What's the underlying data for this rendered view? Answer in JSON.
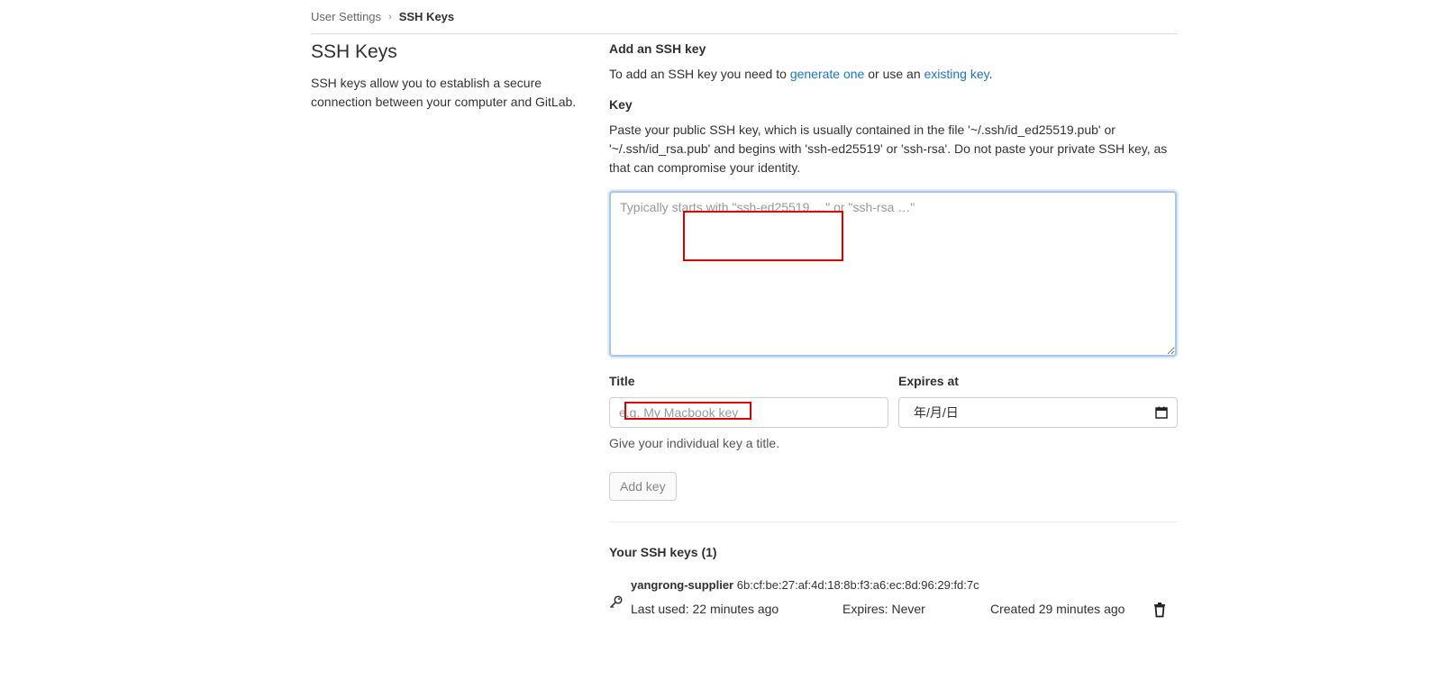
{
  "breadcrumb": {
    "parent": "User Settings",
    "separator": "›",
    "current": "SSH Keys"
  },
  "left": {
    "title": "SSH Keys",
    "description": "SSH keys allow you to establish a secure connection between your computer and GitLab."
  },
  "add_key": {
    "heading": "Add an SSH key",
    "intro_prefix": "To add an SSH key you need to ",
    "generate_link": "generate one",
    "intro_middle": " or use an ",
    "existing_link": "existing key",
    "intro_suffix": ".",
    "key_label": "Key",
    "key_help": "Paste your public SSH key, which is usually contained in the file '~/.ssh/id_ed25519.pub' or '~/.ssh/id_rsa.pub' and begins with 'ssh-ed25519' or 'ssh-rsa'. Do not paste your private SSH key, as that can compromise your identity.",
    "key_placeholder": "Typically starts with \"ssh-ed25519 …\" or \"ssh-rsa …\"",
    "key_value": "",
    "title_label": "Title",
    "title_placeholder": "e.g. My Macbook key",
    "title_value": "",
    "title_help": "Give your individual key a title.",
    "expires_label": "Expires at",
    "expires_value": "年/月/日",
    "submit_label": "Add key"
  },
  "your_keys": {
    "heading": "Your SSH keys (1)",
    "items": [
      {
        "title": "yangrong-supplier",
        "fingerprint": "6b:cf:be:27:af:4d:18:8b:f3:a6:ec:8d:96:29:fd:7c",
        "last_used": "Last used: 22 minutes ago",
        "expires": "Expires: Never",
        "created": "Created 29 minutes ago"
      }
    ]
  },
  "icons": {
    "calendar": "calendar-icon",
    "key": "key-icon",
    "delete": "trash-icon"
  },
  "colors": {
    "link": "#1f75cb",
    "focus_border": "#a7c7ea",
    "annotation": "#e00000"
  }
}
